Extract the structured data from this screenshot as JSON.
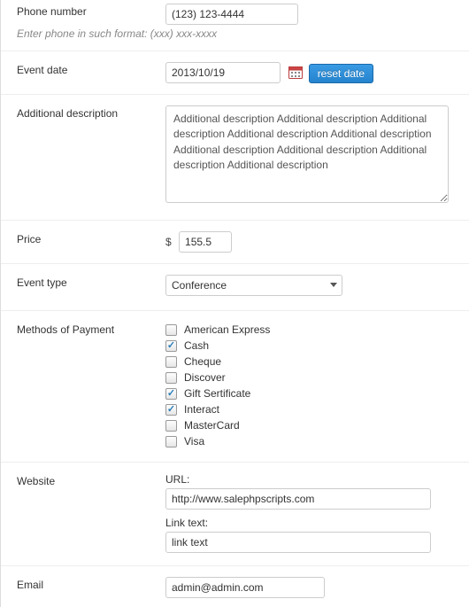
{
  "phone": {
    "label": "Phone number",
    "value": "(123) 123-4444",
    "hint": "Enter phone in such format: (xxx) xxx-xxxx"
  },
  "event_date": {
    "label": "Event date",
    "value": "2013/10/19",
    "reset_label": "reset date"
  },
  "additional_description": {
    "label": "Additional description",
    "value": "Additional description Additional description Additional description Additional description Additional description Additional description Additional description Additional description Additional description"
  },
  "price": {
    "label": "Price",
    "currency": "$",
    "value": "155.5"
  },
  "event_type": {
    "label": "Event type",
    "value": "Conference"
  },
  "payment_methods": {
    "label": "Methods of Payment",
    "options": [
      {
        "label": "American Express",
        "checked": false
      },
      {
        "label": "Cash",
        "checked": true
      },
      {
        "label": "Cheque",
        "checked": false
      },
      {
        "label": "Discover",
        "checked": false
      },
      {
        "label": "Gift Sertificate",
        "checked": true
      },
      {
        "label": "Interact",
        "checked": true
      },
      {
        "label": "MasterCard",
        "checked": false
      },
      {
        "label": "Visa",
        "checked": false
      }
    ]
  },
  "website": {
    "label": "Website",
    "url_label": "URL:",
    "url_value": "http://www.salephpscripts.com",
    "link_text_label": "Link text:",
    "link_text_value": "link text"
  },
  "email": {
    "label": "Email",
    "value": "admin@admin.com"
  }
}
